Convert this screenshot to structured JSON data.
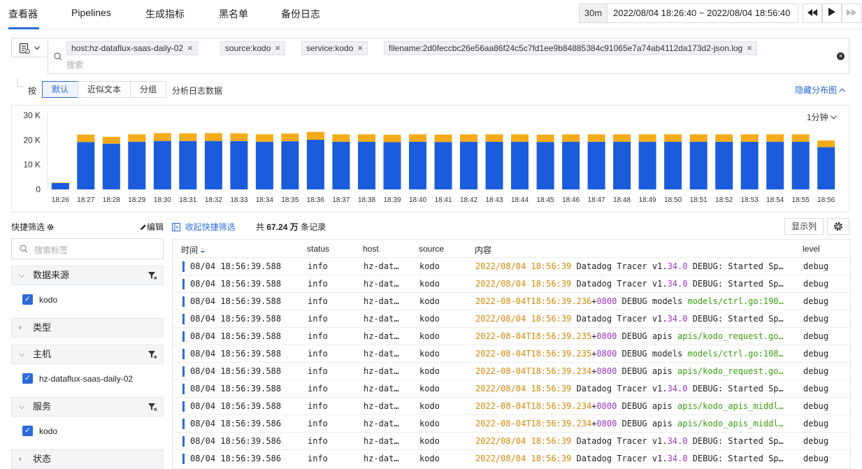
{
  "nav": {
    "tabs": [
      {
        "label": "查看器"
      },
      {
        "label": "Pipelines"
      },
      {
        "label": "生成指标"
      },
      {
        "label": "黑名单"
      },
      {
        "label": "备份日志"
      }
    ],
    "time_quick": "30m",
    "time_range": "2022/08/04 18:26:40 ~ 2022/08/04 18:56:40"
  },
  "filters": {
    "chips": [
      {
        "label": "host:hz-dataflux-saas-daily-02"
      },
      {
        "label": "source:kodo"
      },
      {
        "label": "service:kodo"
      },
      {
        "label": "filename:2d0feccbc26e56aa86f24c5c7fd1ee9b84885384c91065e7a74ab4112da173d2-json.log"
      }
    ],
    "search_placeholder": "搜索"
  },
  "analysis": {
    "by": "按",
    "modes": [
      {
        "label": "默认"
      },
      {
        "label": "近似文本"
      },
      {
        "label": "分组"
      }
    ],
    "suffix": "分析日志数据",
    "hide_label": "隐藏分布图"
  },
  "chart_data": {
    "type": "bar",
    "stacked": true,
    "interval": "1分钟",
    "categories": [
      "18:26",
      "18:27",
      "18:28",
      "18:29",
      "18:30",
      "18:31",
      "18:32",
      "18:33",
      "18:34",
      "18:35",
      "18:36",
      "18:37",
      "18:38",
      "18:39",
      "18:40",
      "18:41",
      "18:42",
      "18:43",
      "18:44",
      "18:45",
      "18:46",
      "18:47",
      "18:48",
      "18:49",
      "18:50",
      "18:51",
      "18:52",
      "18:53",
      "18:54",
      "18:55",
      "18:56"
    ],
    "y_ticks": [
      "30 K",
      "20 K",
      "10 K",
      "0"
    ],
    "ylim": [
      0,
      30000
    ],
    "series": [
      {
        "values": [
          2600,
          19200,
          18500,
          19300,
          19600,
          19600,
          19600,
          19600,
          19300,
          19500,
          20100,
          19300,
          19300,
          19100,
          19300,
          19200,
          19300,
          19300,
          19300,
          19200,
          19300,
          19300,
          19300,
          19300,
          19300,
          19300,
          19300,
          19300,
          19300,
          19300,
          17100
        ],
        "color": "#1b5cdc"
      },
      {
        "values": [
          200,
          3000,
          2800,
          3000,
          3200,
          3100,
          3200,
          3100,
          3000,
          3100,
          3200,
          3000,
          3000,
          3000,
          3000,
          3000,
          3000,
          3000,
          3000,
          3000,
          3000,
          3000,
          3000,
          3000,
          3000,
          3000,
          3000,
          3000,
          3000,
          3000,
          2700
        ],
        "color": "#f5ab19"
      }
    ]
  },
  "quick_filter": {
    "title": "快捷筛选",
    "edit": "编辑",
    "collapse": "收起快捷筛选",
    "search_placeholder": "搜索标签",
    "groups": [
      {
        "name": "数据来源",
        "expanded": true,
        "values": [
          "kodo"
        ]
      },
      {
        "name": "类型",
        "expanded": false,
        "values": []
      },
      {
        "name": "主机",
        "expanded": true,
        "values": [
          "hz-dataflux-saas-daily-02"
        ]
      },
      {
        "name": "服务",
        "expanded": true,
        "values": [
          "kodo"
        ]
      },
      {
        "name": "状态",
        "expanded": false,
        "values": []
      }
    ]
  },
  "table": {
    "total_prefix": "共",
    "total_value": "67.24 万",
    "total_suffix": "条记录",
    "show_columns": "显示列",
    "columns": {
      "time": "时间",
      "status": "status",
      "host": "host",
      "source": "source",
      "content": "内容",
      "level": "level"
    },
    "rows": [
      {
        "time": "08/04 18:56:39.588",
        "status": "info",
        "host": "hz-dat…",
        "source": "kodo",
        "content": [
          {
            "t": "2022/08/04 18:56:39",
            "c": "orange"
          },
          {
            "t": " Datadog Tracer v1.",
            "c": ""
          },
          {
            "t": "34.0",
            "c": "purple"
          },
          {
            "t": " DEBUG: Started Sp…",
            "c": ""
          }
        ],
        "level": "debug"
      },
      {
        "time": "08/04 18:56:39.588",
        "status": "info",
        "host": "hz-dat…",
        "source": "kodo",
        "content": [
          {
            "t": "2022/08/04 18:56:39",
            "c": "orange"
          },
          {
            "t": " Datadog Tracer v1.",
            "c": ""
          },
          {
            "t": "34.0",
            "c": "purple"
          },
          {
            "t": " DEBUG: Started Sp…",
            "c": ""
          }
        ],
        "level": "debug"
      },
      {
        "time": "08/04 18:56:39.588",
        "status": "info",
        "host": "hz-dat…",
        "source": "kodo",
        "content": [
          {
            "t": "2022-08-04T18:56:39.236",
            "c": "orange"
          },
          {
            "t": "+",
            "c": ""
          },
          {
            "t": "0800",
            "c": "purple"
          },
          {
            "t": " DEBUG models ",
            "c": ""
          },
          {
            "t": "models/ctrl.go:190…",
            "c": "green"
          }
        ],
        "level": "debug"
      },
      {
        "time": "08/04 18:56:39.588",
        "status": "info",
        "host": "hz-dat…",
        "source": "kodo",
        "content": [
          {
            "t": "2022/08/04 18:56:39",
            "c": "orange"
          },
          {
            "t": " Datadog Tracer v1.",
            "c": ""
          },
          {
            "t": "34.0",
            "c": "purple"
          },
          {
            "t": " DEBUG: Started Sp…",
            "c": ""
          }
        ],
        "level": "debug"
      },
      {
        "time": "08/04 18:56:39.588",
        "status": "info",
        "host": "hz-dat…",
        "source": "kodo",
        "content": [
          {
            "t": "2022-08-04T18:56:39.235",
            "c": "orange"
          },
          {
            "t": "+",
            "c": ""
          },
          {
            "t": "0800",
            "c": "purple"
          },
          {
            "t": " DEBUG apis ",
            "c": ""
          },
          {
            "t": "apis/kodo_request.go…",
            "c": "green"
          }
        ],
        "level": "debug"
      },
      {
        "time": "08/04 18:56:39.588",
        "status": "info",
        "host": "hz-dat…",
        "source": "kodo",
        "content": [
          {
            "t": "2022-08-04T18:56:39.235",
            "c": "orange"
          },
          {
            "t": "+",
            "c": ""
          },
          {
            "t": "0800",
            "c": "purple"
          },
          {
            "t": " DEBUG models ",
            "c": ""
          },
          {
            "t": "models/ctrl.go:108…",
            "c": "green"
          }
        ],
        "level": "debug"
      },
      {
        "time": "08/04 18:56:39.588",
        "status": "info",
        "host": "hz-dat…",
        "source": "kodo",
        "content": [
          {
            "t": "2022-08-04T18:56:39.234",
            "c": "orange"
          },
          {
            "t": "+",
            "c": ""
          },
          {
            "t": "0800",
            "c": "purple"
          },
          {
            "t": " DEBUG apis ",
            "c": ""
          },
          {
            "t": "apis/kodo_request.go…",
            "c": "green"
          }
        ],
        "level": "debug"
      },
      {
        "time": "08/04 18:56:39.588",
        "status": "info",
        "host": "hz-dat…",
        "source": "kodo",
        "content": [
          {
            "t": "2022/08/04 18:56:39",
            "c": "orange"
          },
          {
            "t": " Datadog Tracer v1.",
            "c": ""
          },
          {
            "t": "34.0",
            "c": "purple"
          },
          {
            "t": " DEBUG: Started Sp…",
            "c": ""
          }
        ],
        "level": "debug"
      },
      {
        "time": "08/04 18:56:39.588",
        "status": "info",
        "host": "hz-dat…",
        "source": "kodo",
        "content": [
          {
            "t": "2022-08-04T18:56:39.234",
            "c": "orange"
          },
          {
            "t": "+",
            "c": ""
          },
          {
            "t": "0800",
            "c": "purple"
          },
          {
            "t": " DEBUG apis ",
            "c": ""
          },
          {
            "t": "apis/kodo_apis_middl…",
            "c": "green"
          }
        ],
        "level": "debug"
      },
      {
        "time": "08/04 18:56:39.586",
        "status": "info",
        "host": "hz-dat…",
        "source": "kodo",
        "content": [
          {
            "t": "2022-08-04T18:56:39.234",
            "c": "orange"
          },
          {
            "t": "+",
            "c": ""
          },
          {
            "t": "0800",
            "c": "purple"
          },
          {
            "t": " DEBUG apis ",
            "c": ""
          },
          {
            "t": "apis/kodo_apis_middl…",
            "c": "green"
          }
        ],
        "level": "debug"
      },
      {
        "time": "08/04 18:56:39.586",
        "status": "info",
        "host": "hz-dat…",
        "source": "kodo",
        "content": [
          {
            "t": "2022/08/04 18:56:39",
            "c": "orange"
          },
          {
            "t": " Datadog Tracer v1.",
            "c": ""
          },
          {
            "t": "34.0",
            "c": "purple"
          },
          {
            "t": " DEBUG: Started Sp…",
            "c": ""
          }
        ],
        "level": "debug"
      },
      {
        "time": "08/04 18:56:39.586",
        "status": "info",
        "host": "hz-dat…",
        "source": "kodo",
        "content": [
          {
            "t": "2022/08/04 18:56:39",
            "c": "orange"
          },
          {
            "t": " Datadog Tracer v1.",
            "c": ""
          },
          {
            "t": "34.0",
            "c": "purple"
          },
          {
            "t": " DEBUG: Started Sp…",
            "c": ""
          }
        ],
        "level": "debug"
      }
    ]
  }
}
